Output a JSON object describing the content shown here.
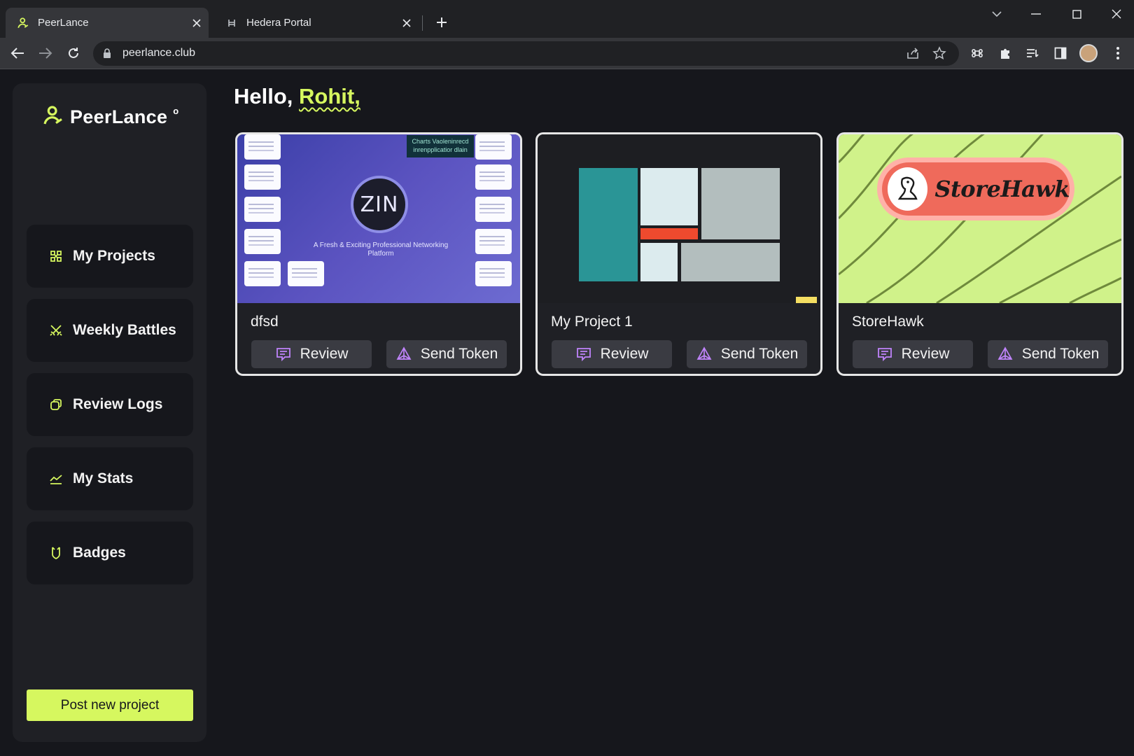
{
  "browser": {
    "tabs": [
      {
        "title": "PeerLance",
        "active": true,
        "favicon": "peerlance-logo-icon"
      },
      {
        "title": "Hedera Portal",
        "active": false,
        "favicon": "hedera-h-icon"
      }
    ],
    "url": "peerlance.club"
  },
  "sidebar": {
    "brand": "PeerLance",
    "brand_mark": "o",
    "items": [
      {
        "label": "My Projects",
        "icon": "projects-icon"
      },
      {
        "label": "Weekly Battles",
        "icon": "battles-icon"
      },
      {
        "label": "Review Logs",
        "icon": "review-logs-icon"
      },
      {
        "label": "My Stats",
        "icon": "stats-icon"
      },
      {
        "label": "Badges",
        "icon": "badge-icon"
      }
    ],
    "post_button": "Post new project"
  },
  "greeting": {
    "hello": "Hello, ",
    "name": "Rohit,"
  },
  "projects": [
    {
      "title": "dfsd",
      "review_label": "Review",
      "send_label": "Send Token",
      "thumb": {
        "banner": "Charts Vaoleninrecd inrenpplicatior dlain",
        "logo": "ZIN",
        "tagline": "A Fresh & Exciting Professional Networking Platform"
      }
    },
    {
      "title": "My Project 1",
      "review_label": "Review",
      "send_label": "Send Token"
    },
    {
      "title": "StoreHawk",
      "review_label": "Review",
      "send_label": "Send Token",
      "thumb": {
        "logo_text": "StoreHawk"
      }
    }
  ],
  "colors": {
    "accent": "#d6f75f",
    "background": "#16171c",
    "panel": "#1f2025",
    "icon_purple": "#c084fc"
  }
}
